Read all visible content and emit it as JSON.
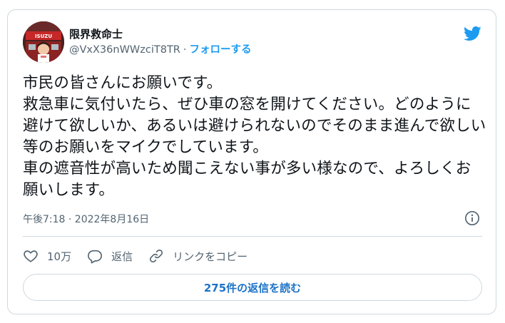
{
  "author": {
    "display_name": "限界救命士",
    "handle": "@VxX36nWWzciT8TR",
    "separator": "·",
    "follow_label": "フォローする",
    "avatar_text": "ISUZU"
  },
  "tweet": {
    "text": "市民の皆さんにお願いです。\n救急車に気付いたら、ぜひ車の窓を開けてください。どのように避けて欲しいか、あるいは避けられないのでそのまま進んで欲しい等のお願いをマイクでしています。\n車の遮音性が高いため聞こえない事が多い様なので、よろしくお願いします。",
    "timestamp": "午後7:18 · 2022年8月16日"
  },
  "actions": {
    "like_count": "10万",
    "reply_label": "返信",
    "copy_link_label": "リンクをコピー"
  },
  "replies_button": {
    "label": "275件の返信を読む"
  },
  "colors": {
    "accent": "#1d9bf0",
    "text_primary": "#0f1419",
    "text_secondary": "#536471",
    "border": "#cfd9de"
  }
}
